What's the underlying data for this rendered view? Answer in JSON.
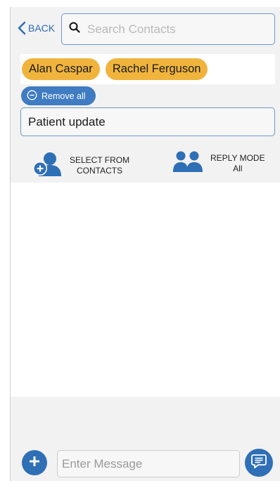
{
  "header": {
    "back_label": "BACK",
    "search_placeholder": "Search Contacts",
    "search_value": ""
  },
  "recipients": [
    {
      "name": "Alan Caspar"
    },
    {
      "name": "Rachel Ferguson"
    }
  ],
  "remove_all_label": "Remove all",
  "subject_value": "Patient update",
  "actions": {
    "select_from_contacts": {
      "line1": "SELECT FROM",
      "line2": "CONTACTS"
    },
    "reply_mode": {
      "line1": "REPLY MODE",
      "line2": "All"
    }
  },
  "composer": {
    "message_placeholder": "Enter Message",
    "message_value": ""
  },
  "colors": {
    "accent": "#2f6fb6",
    "chip": "#f0b43d",
    "border": "#6f98c9"
  },
  "icons": {
    "back": "chevron-left-icon",
    "search": "search-icon",
    "remove_all": "minus-circle-icon",
    "select_contacts": "add-person-icon",
    "reply_mode": "group-icon",
    "add": "plus-icon",
    "send": "chat-bubble-icon"
  }
}
